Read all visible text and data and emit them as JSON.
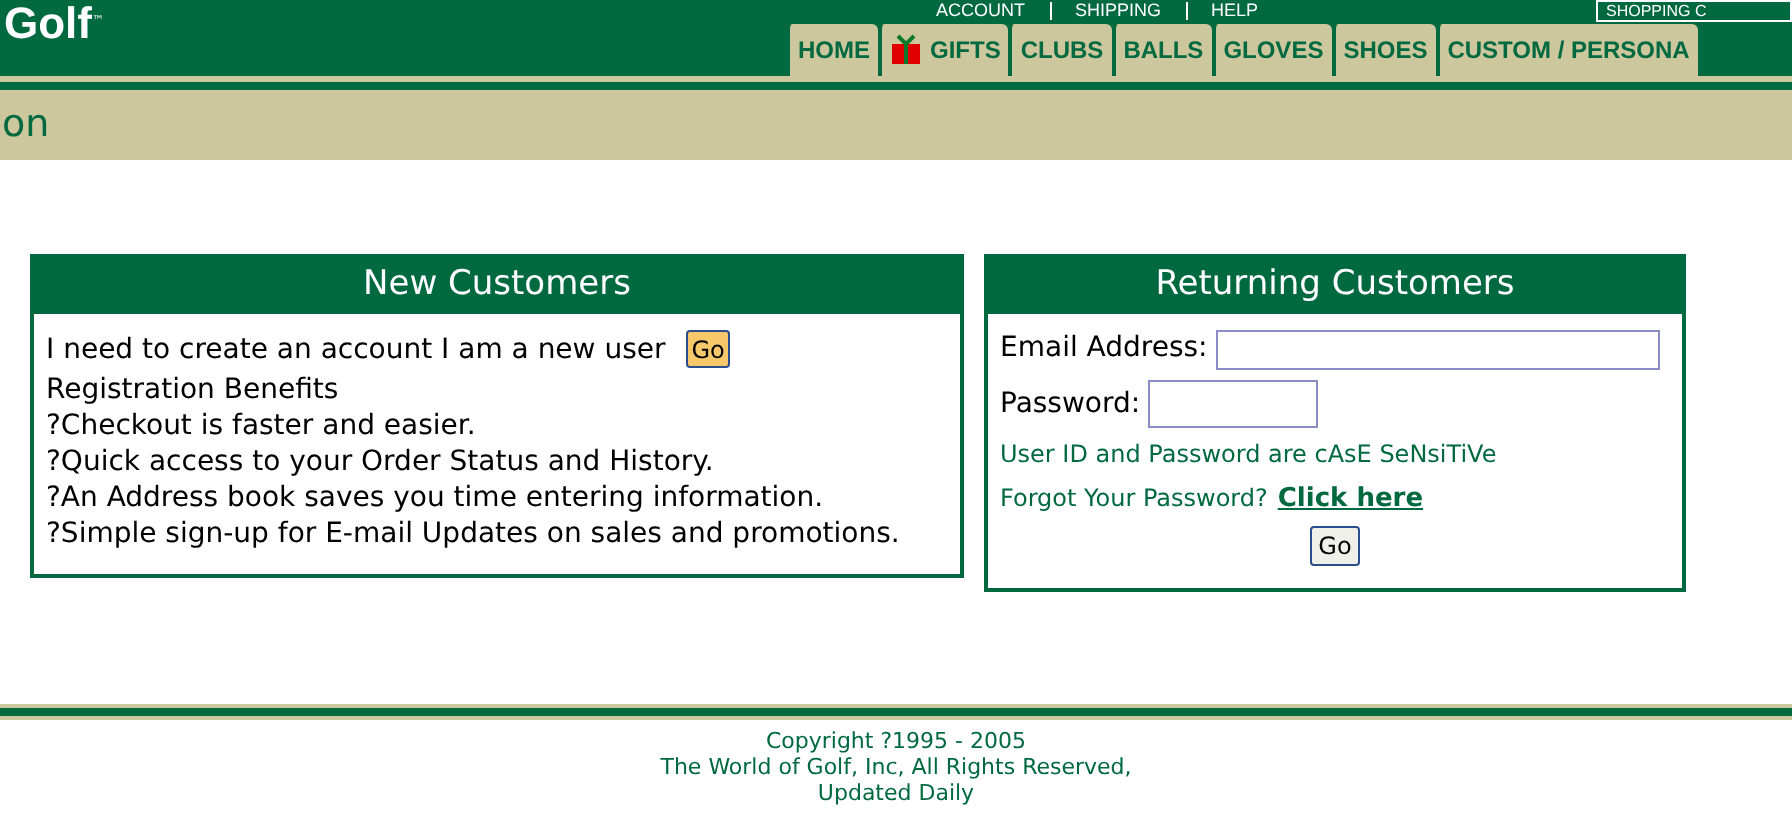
{
  "header": {
    "logo": "Golf",
    "logo_mark": "™",
    "top_links": [
      "ACCOUNT",
      "SHIPPING",
      "HELP"
    ],
    "cart_label": "SHOPPING C"
  },
  "nav_tabs": [
    {
      "label": "HOME",
      "kind": "plain"
    },
    {
      "label": "GIFTS",
      "kind": "gift"
    },
    {
      "label": "CLUBS",
      "kind": "plain"
    },
    {
      "label": "BALLS",
      "kind": "plain"
    },
    {
      "label": "GLOVES",
      "kind": "plain"
    },
    {
      "label": "SHOES",
      "kind": "plain"
    },
    {
      "label": "CUSTOM / PERSONA",
      "kind": "plain"
    }
  ],
  "page_title": "on",
  "new_customers": {
    "title": "New Customers",
    "intro": "I need to create an account I am a new user",
    "button": "Go",
    "benefits_title": "Registration Benefits",
    "benefits": [
      "?Checkout is faster and easier.",
      "?Quick access to your Order Status and History.",
      "?An Address book saves you time entering information.",
      "?Simple sign-up for E-mail Updates on sales and promotions."
    ]
  },
  "returning_customers": {
    "title": "Returning Customers",
    "email_label": "Email Address:",
    "password_label": "Password:",
    "note": "User ID and Password are cAsE SeNsiTiVe",
    "forgot": "Forgot Your Password?",
    "forgot_link": "Click here",
    "button": "Go"
  },
  "footer": [
    "Copyright ?1995 - 2005",
    "The World of Golf, Inc, All Rights Reserved,",
    "Updated Daily"
  ]
}
